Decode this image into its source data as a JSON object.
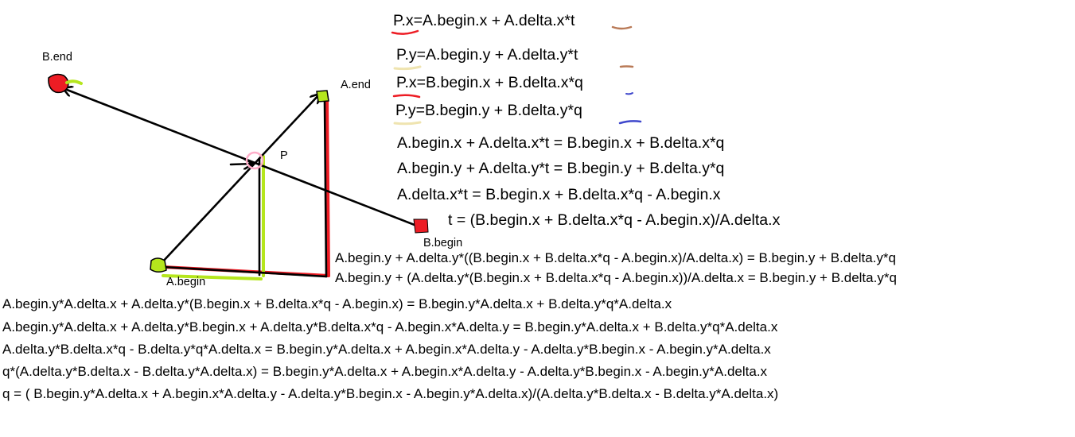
{
  "labels": {
    "b_end": "B.end",
    "a_end": "A.end",
    "p": "P",
    "b_begin": "B.begin",
    "a_begin": "A.begin"
  },
  "equations_top": [
    "P.x=A.begin.x + A.delta.x*t",
    "P.y=A.begin.y + A.delta.y*t",
    "P.x=B.begin.x + B.delta.x*q",
    "P.y=B.begin.y + B.delta.y*q",
    "A.begin.x + A.delta.x*t = B.begin.x + B.delta.x*q",
    "A.begin.y + A.delta.y*t = B.begin.y + B.delta.y*q",
    "A.delta.x*t = B.begin.x + B.delta.x*q - A.begin.x",
    "t = (B.begin.x + B.delta.x*q - A.begin.x)/A.delta.x"
  ],
  "equations_mid": [
    "A.begin.y + A.delta.y*((B.begin.x + B.delta.x*q - A.begin.x)/A.delta.x) = B.begin.y + B.delta.y*q",
    "A.begin.y + (A.delta.y*(B.begin.x + B.delta.x*q - A.begin.x))/A.delta.x = B.begin.y + B.delta.y*q"
  ],
  "equations_bottom": [
    "A.begin.y*A.delta.x + A.delta.y*(B.begin.x + B.delta.x*q - A.begin.x) = B.begin.y*A.delta.x + B.delta.y*q*A.delta.x",
    "A.begin.y*A.delta.x + A.delta.y*B.begin.x + A.delta.y*B.delta.x*q - A.begin.x*A.delta.y = B.begin.y*A.delta.x + B.delta.y*q*A.delta.x",
    "A.delta.y*B.delta.x*q -  B.delta.y*q*A.delta.x = B.begin.y*A.delta.x + A.begin.x*A.delta.y - A.delta.y*B.begin.x - A.begin.y*A.delta.x",
    "q*(A.delta.y*B.delta.x - B.delta.y*A.delta.x) = B.begin.y*A.delta.x + A.begin.x*A.delta.y - A.delta.y*B.begin.x - A.begin.y*A.delta.x",
    "q = ( B.begin.y*A.delta.x + A.begin.x*A.delta.y - A.delta.y*B.begin.x - A.begin.y*A.delta.x)/(A.delta.y*B.delta.x - B.delta.y*A.delta.x)"
  ],
  "colors": {
    "ink": "#000000",
    "red": "#ed1c24",
    "green": "#b5e61d",
    "pink": "#ffaec9",
    "underline_brown": "#b97a57",
    "underline_tan": "#efe4b0",
    "underline_blue": "#3f48cc"
  }
}
